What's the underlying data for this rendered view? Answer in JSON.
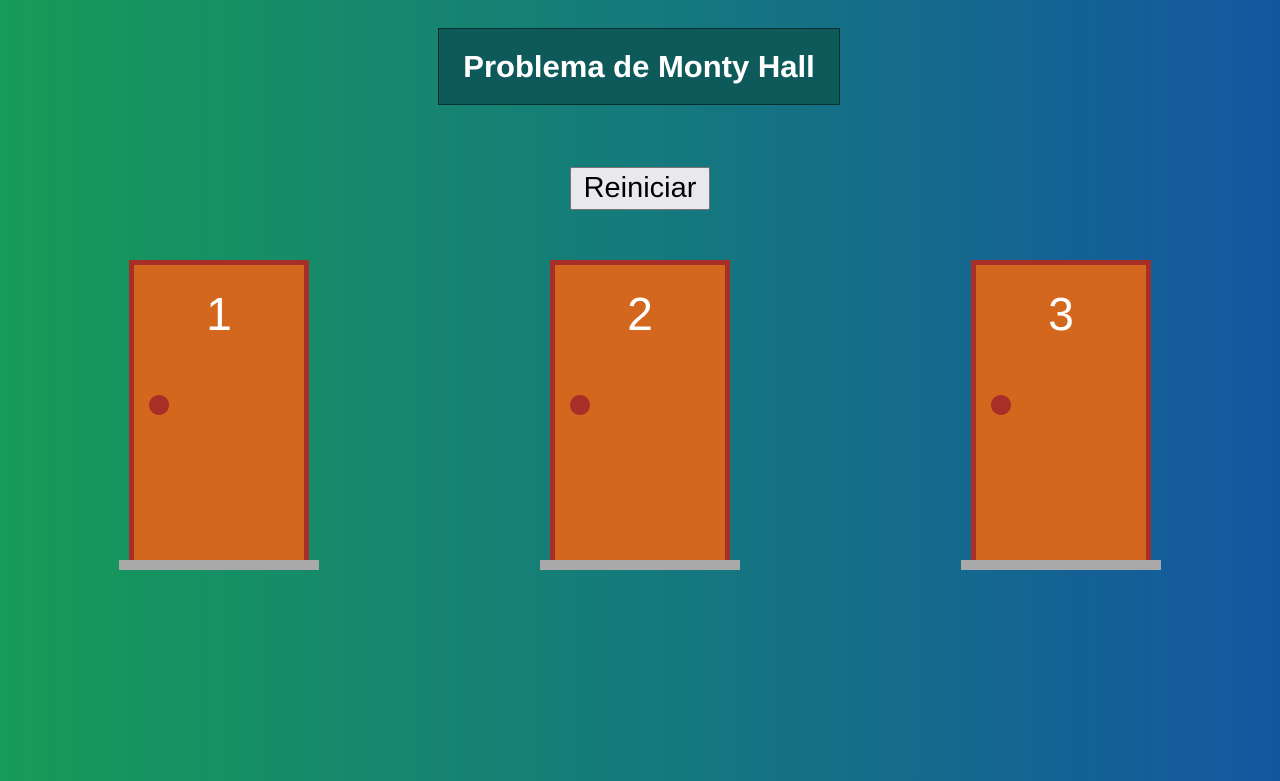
{
  "header": {
    "title": "Problema de Monty Hall"
  },
  "controls": {
    "reset_label": "Reiniciar"
  },
  "doors": [
    {
      "number": "1"
    },
    {
      "number": "2"
    },
    {
      "number": "3"
    }
  ],
  "colors": {
    "background_start": "#179b58",
    "background_end": "#1457a0",
    "title_box": "#0e5a5a",
    "door_fill": "#d4671e",
    "door_frame": "#a82f28",
    "door_knob": "#a82f28",
    "door_step": "#a9a9a9"
  }
}
